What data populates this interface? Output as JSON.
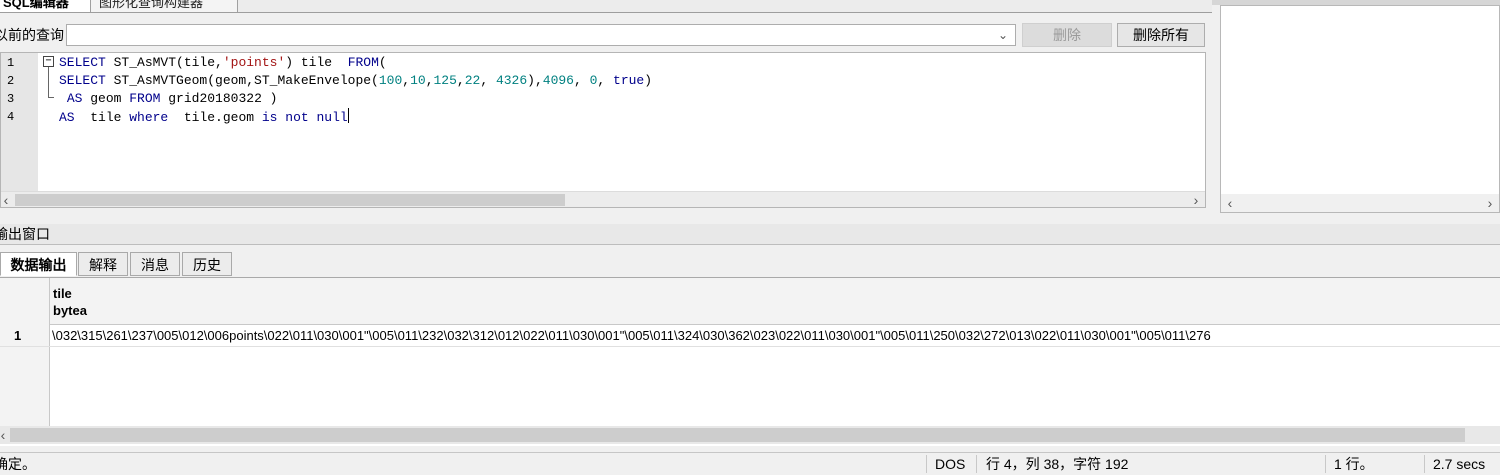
{
  "tabs": [
    "SQL编辑器",
    "图形化查询构建器"
  ],
  "previous_queries": {
    "label": "以前的查询",
    "selected_value": "",
    "delete_label": "删除",
    "delete_all_label": "删除所有"
  },
  "editor": {
    "line_numbers": [
      "1",
      "2",
      "3",
      "4"
    ],
    "lines": [
      [
        [
          "kw",
          "SELECT"
        ],
        [
          "plain",
          " ST_AsMVT(tile,"
        ],
        [
          "str",
          "'points'"
        ],
        [
          "plain",
          ") tile  "
        ],
        [
          "kw",
          "FROM"
        ],
        [
          "plain",
          "("
        ]
      ],
      [
        [
          "kw",
          "SELECT"
        ],
        [
          "plain",
          " ST_AsMVTGeom(geom,ST_MakeEnvelope("
        ],
        [
          "num",
          "100"
        ],
        [
          "plain",
          ","
        ],
        [
          "num",
          "10"
        ],
        [
          "plain",
          ","
        ],
        [
          "num",
          "125"
        ],
        [
          "plain",
          ","
        ],
        [
          "num",
          "22"
        ],
        [
          "plain",
          ", "
        ],
        [
          "num",
          "4326"
        ],
        [
          "plain",
          "),"
        ],
        [
          "num",
          "4096"
        ],
        [
          "plain",
          ", "
        ],
        [
          "num",
          "0"
        ],
        [
          "plain",
          ", "
        ],
        [
          "kw",
          "true"
        ],
        [
          "plain",
          ")"
        ]
      ],
      [
        [
          "plain",
          " "
        ],
        [
          "kw",
          "AS"
        ],
        [
          "plain",
          " geom "
        ],
        [
          "kw",
          "FROM"
        ],
        [
          "plain",
          " grid20180322 )"
        ]
      ],
      [
        [
          "kw",
          "AS"
        ],
        [
          "plain",
          "  tile "
        ],
        [
          "kw",
          "where"
        ],
        [
          "plain",
          "  tile.geom "
        ],
        [
          "kw",
          "is"
        ],
        [
          "plain",
          " "
        ],
        [
          "kw",
          "not"
        ],
        [
          "plain",
          " "
        ],
        [
          "kw",
          "null"
        ]
      ]
    ]
  },
  "output": {
    "title": "输出窗口",
    "tabs": [
      "数据输出",
      "解释",
      "消息",
      "历史"
    ],
    "columns": [
      {
        "name": "tile",
        "type": "bytea"
      }
    ],
    "rows": [
      {
        "num": "1",
        "value": "\\032\\315\\261\\237\\005\\012\\006points\\022\\011\\030\\001\"\\005\\011\\232\\032\\312\\012\\022\\011\\030\\001\"\\005\\011\\324\\030\\362\\023\\022\\011\\030\\001\"\\005\\011\\250\\032\\272\\013\\022\\011\\030\\001\"\\005\\011\\276"
      }
    ]
  },
  "status": {
    "message": "确定。",
    "line_ending": "DOS",
    "position": "行 4，列 38，字符 192",
    "rows": "1 行。",
    "time": "2.7 secs"
  },
  "colors": {
    "keyword": "#00008b",
    "string": "#a31515",
    "number": "#008080"
  }
}
